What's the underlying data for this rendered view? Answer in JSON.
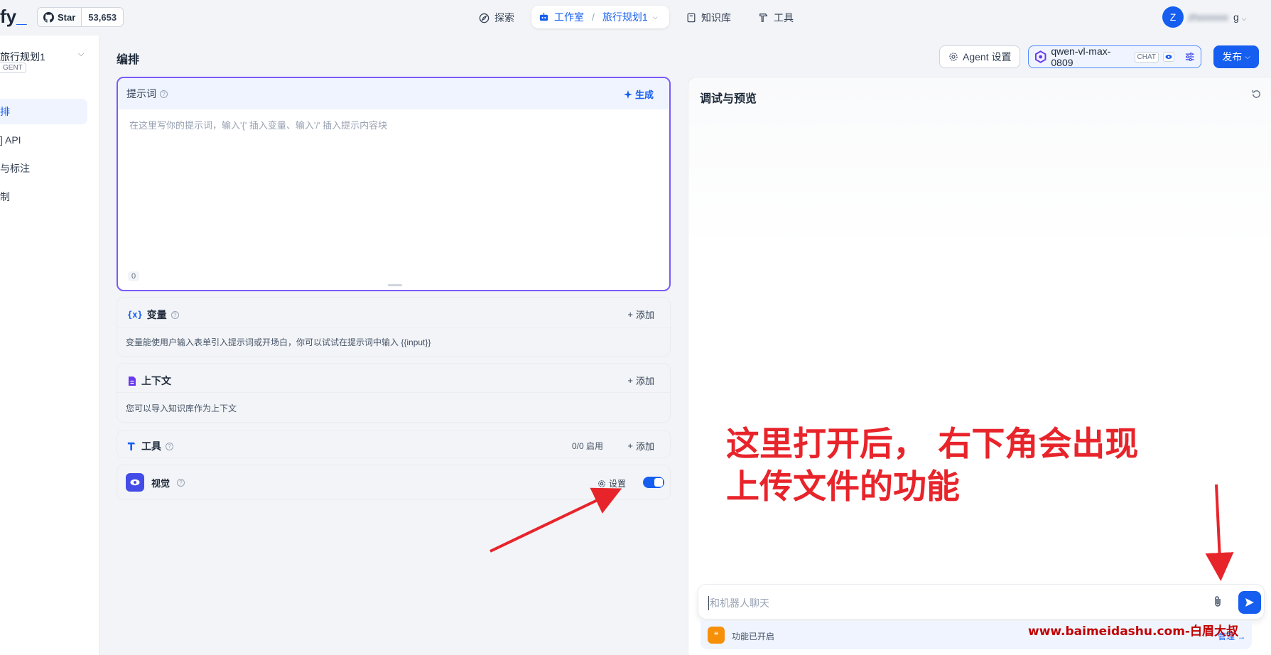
{
  "nav": {
    "logo_text": "fy",
    "github": {
      "star_label": "Star",
      "count": "53,653"
    },
    "explore": "探索",
    "studio": "工作室",
    "app": "旅行规划1",
    "knowledge": "知识库",
    "tools": "工具",
    "avatar_letter": "Z",
    "username_tail": "g"
  },
  "sidebar": {
    "app_name": "旅行规划1",
    "app_tag": "GENT",
    "items": [
      {
        "label": "排"
      },
      {
        "label": "] API"
      },
      {
        "label": "与标注"
      },
      {
        "label": "制"
      }
    ]
  },
  "header": {
    "title": "编排",
    "agent_settings": "Agent 设置",
    "model_name": "qwen-vl-max-0809",
    "model_tag": "CHAT",
    "publish": "发布"
  },
  "prompt": {
    "label": "提示词",
    "generate": "生成",
    "placeholder": "在这里写你的提示词，输入'{' 插入变量、输入'/' 插入提示内容块",
    "char_count": "0"
  },
  "variables": {
    "title": "变量",
    "add": "添加",
    "desc": "变量能使用户输入表单引入提示词或开场白，你可以试试在提示词中输入 {{input}}"
  },
  "context": {
    "title": "上下文",
    "add": "添加",
    "desc": "您可以导入知识库作为上下文"
  },
  "tools_card": {
    "title": "工具",
    "enabled": "0/0 启用",
    "add": "添加"
  },
  "vision": {
    "title": "视觉",
    "settings": "设置",
    "enabled": true
  },
  "debug": {
    "title": "调试与预览",
    "chat_placeholder": "和机器人聊天",
    "feature_status": "功能已开启",
    "manage": "管理"
  },
  "annotation": {
    "line1": "这里打开后， 右下角会出现",
    "line2": "上传文件的功能",
    "watermark": "www.baimeidashu.com-白眉大叔",
    "color": "#e8242b"
  },
  "colors": {
    "primary": "#155eef",
    "prompt_border": "#7a5af8"
  }
}
